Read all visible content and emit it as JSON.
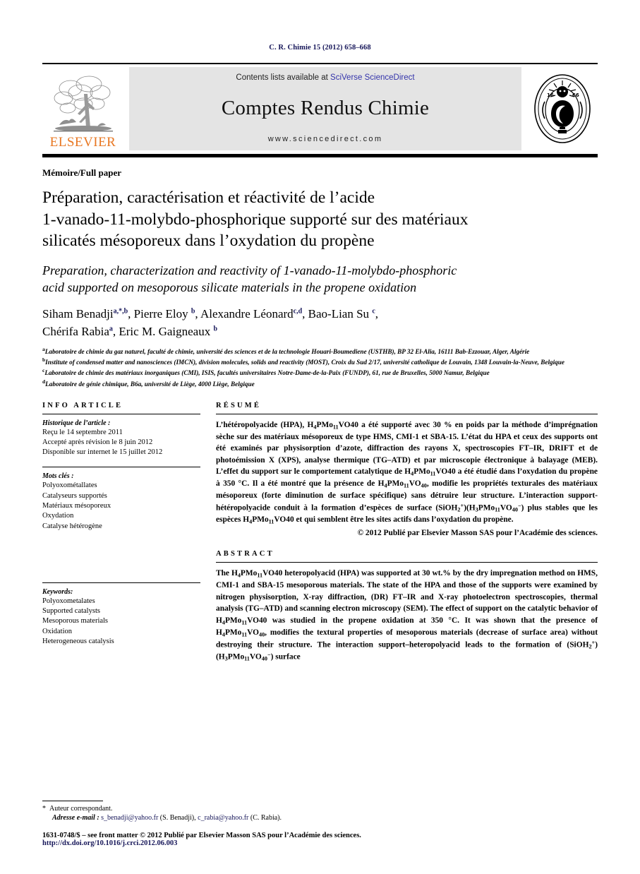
{
  "running_head": "C. R. Chimie 15 (2012) 658–668",
  "masthead": {
    "publisher_logo_label": "ELSEVIER",
    "contents_prefix": "Contents lists available at ",
    "contents_link": "SciVerse ScienceDirect",
    "journal_title": "Comptes Rendus Chimie",
    "journal_url": "www.sciencedirect.com",
    "seal_label": "INSTITUT DE FRANCE ACADÉMIE DES SCIENCES 1666"
  },
  "article": {
    "type": "Mémoire/Full paper",
    "title_fr_lines": [
      "Préparation, caractérisation et réactivité de l’acide",
      "1-vanado-11-molybdo-phosphorique supporté sur des matériaux",
      "silicatés mésoporeux dans l’oxydation du propène"
    ],
    "title_en_lines": [
      "Preparation, characterization and reactivity of 1-vanado-11-molybdo-phosphoric",
      "acid supported on mesoporous silicate materials in the propene oxidation"
    ],
    "authors_line1": "Siham Benadji",
    "authors_line1_sup": "a,*,b",
    "authors": [
      {
        "name": "Siham Benadji",
        "sup": "a,*,b"
      },
      {
        "name": "Pierre Eloy",
        "sup": "b"
      },
      {
        "name": "Alexandre Léonard",
        "sup": "c,d"
      },
      {
        "name": "Bao-Lian Su",
        "sup": "c"
      },
      {
        "name": "Chérifa Rabia",
        "sup": "a"
      },
      {
        "name": "Eric M. Gaigneaux",
        "sup": "b"
      }
    ],
    "affiliations": [
      {
        "mark": "a",
        "text": "Laboratoire de chimie du gaz naturel, faculté de chimie, université des sciences et de la technologie Houari-Boumediene (USTHB), BP 32 El-Alia, 16111 Bab-Ezzouar, Alger, Algérie"
      },
      {
        "mark": "b",
        "text": "Institute of condensed matter and nanosciences (IMCN), division molecules, solids and reactivity (MOST), Croix du Sud 2/17, université catholique de Louvain, 1348 Louvain-la-Neuve, Belgique"
      },
      {
        "mark": "c",
        "text": "Laboratoire de chimie des matériaux inorganiques (CMI), ISIS, facultés universitaires Notre-Dame-de-la-Paix (FUNDP), 61, rue de Bruxelles, 5000 Namur, Belgique"
      },
      {
        "mark": "d",
        "text": "Laboratoire de génie chimique, B6a, université de Liège, 4000 Liège, Belgique"
      }
    ]
  },
  "info_article": {
    "heading": "INFO ARTICLE",
    "history_label": "Historique de l’article :",
    "history_lines": [
      "Reçu le 14 septembre 2011",
      "Accepté après révision le 8 juin 2012",
      "Disponible sur internet le 15 juillet 2012"
    ],
    "keywords_fr_label": "Mots clés :",
    "keywords_fr": [
      "Polyoxométallates",
      "Catalyseurs supportés",
      "Matériaux mésoporeux",
      "Oxydation",
      "Catalyse hétérogène"
    ],
    "keywords_en_label": "Keywords:",
    "keywords_en": [
      "Polyoxometalates",
      "Supported catalysts",
      "Mesoporous materials",
      "Oxidation",
      "Heterogeneous catalysis"
    ]
  },
  "resume": {
    "heading": "RÉSUMÉ",
    "body": "L’hétéropolyacide (HPA), H4PMo11VO40 a été supporté avec 30 % en poids par la méthode d’imprégnation sèche sur des matériaux mésoporeux de type HMS, CMI-1 et SBA-15. L’état du HPA et ceux des supports ont été examinés par physisorption d’azote, diffraction des rayons X, spectroscopies FT–IR, DRIFT et de photoémission X (XPS), analyse thermique (TG–ATD) et par microscopie électronique à balayage (MEB). L’effet du support sur le comportement catalytique de H4PMo11VO40 a été étudié dans l’oxydation du propène à 350 °C. Il a été montré que la présence de H4PMo11VO40, modifie les propriétés texturales des matériaux mésoporeux (forte diminution de surface spécifique) sans détruire leur structure. L’interaction support-hétéropolyacide conduit à la formation d’espèces de surface (SiOH2+)(H3PMo11VO40−) plus stables que les espèces H4PMo11VO40 et qui semblent être les sites actifs dans l’oxydation du propène.",
    "copyright": "© 2012 Publié par Elsevier Masson SAS pour l’Académie des sciences."
  },
  "abstract": {
    "heading": "ABSTRACT",
    "body": "The H4PMo11VO40 heteropolyacid (HPA) was supported at 30 wt.% by the dry impregnation method on HMS, CMI-1 and SBA-15 mesoporous materials. The state of the HPA and those of the supports were examined by nitrogen physisorption, X-ray diffraction, (DR) FT–IR and X-ray photoelectron spectroscopies, thermal analysis (TG–ATD) and scanning electron microscopy (SEM). The effect of support on the catalytic behavior of H4PMo11VO40 was studied in the propene oxidation at 350 °C. It was shown that the presence of H4PMo11VO40, modifies the textural properties of mesoporous materials (decrease of surface area) without destroying their structure. The interaction support–heteropolyacid leads to the formation of (SiOH2+)(H3PMo11VO40−) surface"
  },
  "footer": {
    "corresponding_star": "*",
    "corresponding_label": "Auteur correspondant.",
    "email_label": "Adresse e-mail :",
    "email1": "s_benadji@yahoo.fr",
    "email1_owner": "(S. Benadji),",
    "email2": "c_rabia@yahoo.fr",
    "email2_owner": "(C. Rabia).",
    "front_matter": "1631-0748/$ – see front matter © 2012 Publié par Elsevier Masson SAS pour l’Académie des sciences.",
    "doi": "http://dx.doi.org/10.1016/j.crci.2012.06.003"
  },
  "colors": {
    "link_blue": "#161659",
    "sciencedirect_blue": "#3333AA",
    "elsevier_orange": "#E87722",
    "masthead_grey": "#E4E4E4"
  }
}
